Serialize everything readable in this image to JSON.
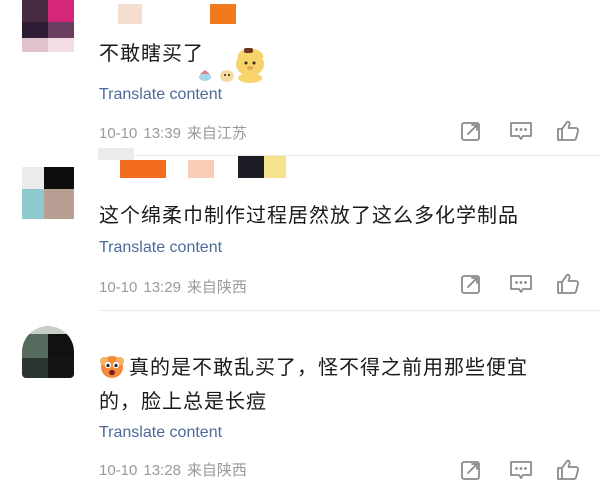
{
  "comments": [
    {
      "text": "不敢瞎买了",
      "translate": "Translate content",
      "date": "10-10",
      "time": "13:39",
      "location": "来自江苏"
    },
    {
      "text": "这个绵柔巾制作过程居然放了这么多化学制品",
      "translate": "Translate content",
      "date": "10-10",
      "time": "13:29",
      "location": "来自陕西"
    },
    {
      "text": "真的是不敢乱买了，怪不得之前用那些便宜的，脸上总是长痘",
      "translate": "Translate content",
      "date": "10-10",
      "time": "13:28",
      "location": "来自陕西"
    }
  ],
  "icons": {
    "share": "share-icon",
    "comment": "comment-icon",
    "like": "like-icon",
    "sticker": "pompompurin-sticker",
    "emoji": "frightened-face-emoji"
  },
  "colors": {
    "text": "#1a1a1a",
    "link": "#4a6b9a",
    "meta": "#9a9a9a",
    "icon": "#8a8a8a"
  }
}
